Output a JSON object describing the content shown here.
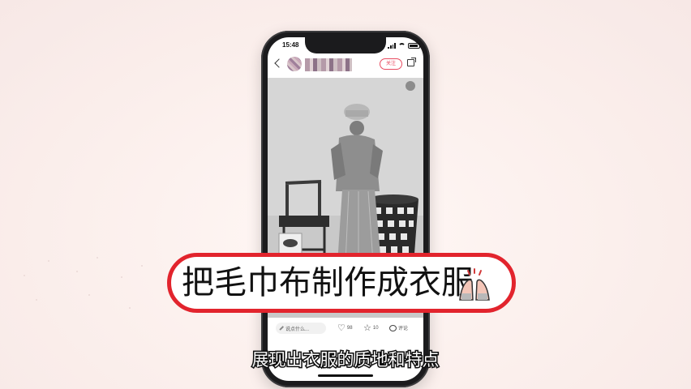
{
  "phone": {
    "status_time": "15:48",
    "nav": {
      "username": "",
      "follow_label": "关注"
    },
    "photo_icons": [
      "sound-icon"
    ],
    "bottom_bar": {
      "comment_placeholder": "说点什么...",
      "likes": "98",
      "favorites": "10",
      "comments_label": "评论"
    }
  },
  "caption": {
    "text": "把毛巾布制作成衣服",
    "emoji": "raised-hands-icon",
    "border_color": "#e2242d"
  },
  "subtitle": {
    "text": "展现出衣服的质地和特点"
  },
  "colors": {
    "accent": "#e84a5f",
    "background": "#fbf0ee"
  }
}
